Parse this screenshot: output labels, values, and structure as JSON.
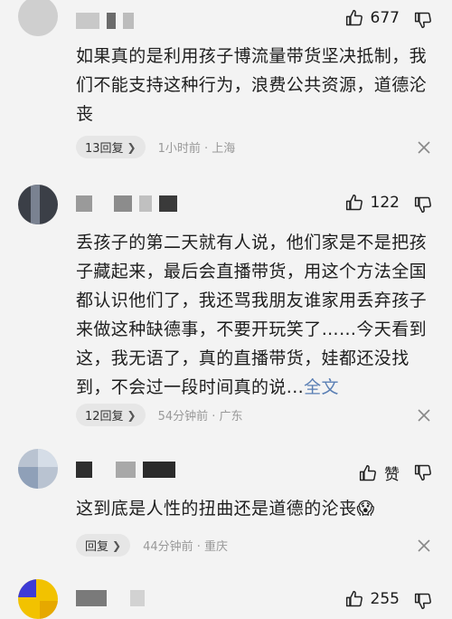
{
  "comments": [
    {
      "likes": "677",
      "text": "如果真的是利用孩子博流量带货坚决抵制，我们不能支持这种行为，浪费公共资源，道德沦丧",
      "replies_label": "13回复",
      "meta": "1小时前 · 上海"
    },
    {
      "likes": "122",
      "text": "丢孩子的第二天就有人说，他们家是不是把孩子藏起来，最后会直播带货，用这个方法全国都认识他们了，我还骂我朋友谁家用丢弃孩子来做这种缺德事，不要开玩笑了……今天看到这，我无语了，真的直播带货，娃都还没找到，不会过一段时间真的说...",
      "full_label": "全文",
      "replies_label": "12回复",
      "meta": "54分钟前 · 广东"
    },
    {
      "likes": "赞",
      "text": "这到底是人性的扭曲还是道德的沦丧",
      "emoji": "😱",
      "replies_label": "回复",
      "meta": "44分钟前 · 重庆"
    },
    {
      "likes": "255"
    }
  ],
  "icons": {
    "like": "thumbs-up-icon",
    "dislike": "thumbs-down-icon",
    "close": "close-icon",
    "chevron": "chevron-right-icon"
  }
}
